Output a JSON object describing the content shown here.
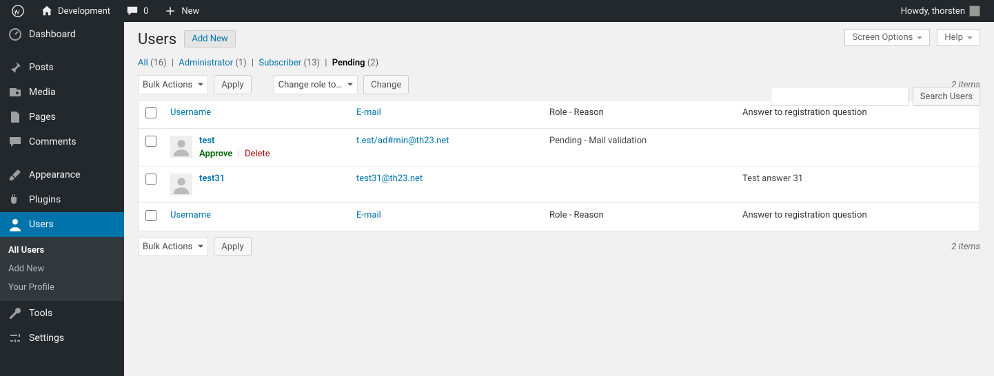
{
  "adminbar": {
    "site_name": "Development",
    "comments_count": "0",
    "new_label": "New",
    "howdy": "Howdy, thorsten"
  },
  "sidebar": {
    "items": [
      {
        "name": "dashboard",
        "label": "Dashboard",
        "icon": "dashboard"
      },
      {
        "name": "posts",
        "label": "Posts",
        "icon": "pin"
      },
      {
        "name": "media",
        "label": "Media",
        "icon": "media"
      },
      {
        "name": "pages",
        "label": "Pages",
        "icon": "page"
      },
      {
        "name": "comments",
        "label": "Comments",
        "icon": "comment"
      },
      {
        "name": "appearance",
        "label": "Appearance",
        "icon": "brush"
      },
      {
        "name": "plugins",
        "label": "Plugins",
        "icon": "plug"
      },
      {
        "name": "users",
        "label": "Users",
        "icon": "user",
        "current": true,
        "submenu": [
          {
            "label": "All Users",
            "current": true
          },
          {
            "label": "Add New"
          },
          {
            "label": "Your Profile"
          }
        ]
      },
      {
        "name": "tools",
        "label": "Tools",
        "icon": "wrench"
      },
      {
        "name": "settings",
        "label": "Settings",
        "icon": "sliders"
      }
    ]
  },
  "screen": {
    "screen_options": "Screen Options",
    "help": "Help"
  },
  "page": {
    "title": "Users",
    "add_new": "Add New"
  },
  "filters": [
    {
      "label": "All",
      "count": "(16)"
    },
    {
      "label": "Administrator",
      "count": "(1)"
    },
    {
      "label": "Subscriber",
      "count": "(13)"
    },
    {
      "label": "Pending",
      "count": "(2)",
      "current": true
    }
  ],
  "bulk": {
    "bulk_actions": "Bulk Actions",
    "apply": "Apply",
    "change_role": "Change role to…",
    "change": "Change"
  },
  "items_count": "2 items",
  "search": {
    "button": "Search Users",
    "value": ""
  },
  "columns": {
    "username": "Username",
    "email": "E-mail",
    "role": "Role - Reason",
    "answer": "Answer to registration question"
  },
  "rows": [
    {
      "username": "test",
      "email": "t.est/ad#min@th23.net",
      "role": "Pending - Mail validation",
      "answer": "",
      "actions": {
        "approve": "Approve",
        "delete": "Delete"
      }
    },
    {
      "username": "test31",
      "email": "test31@th23.net",
      "role": "",
      "answer": "Test answer 31"
    }
  ]
}
